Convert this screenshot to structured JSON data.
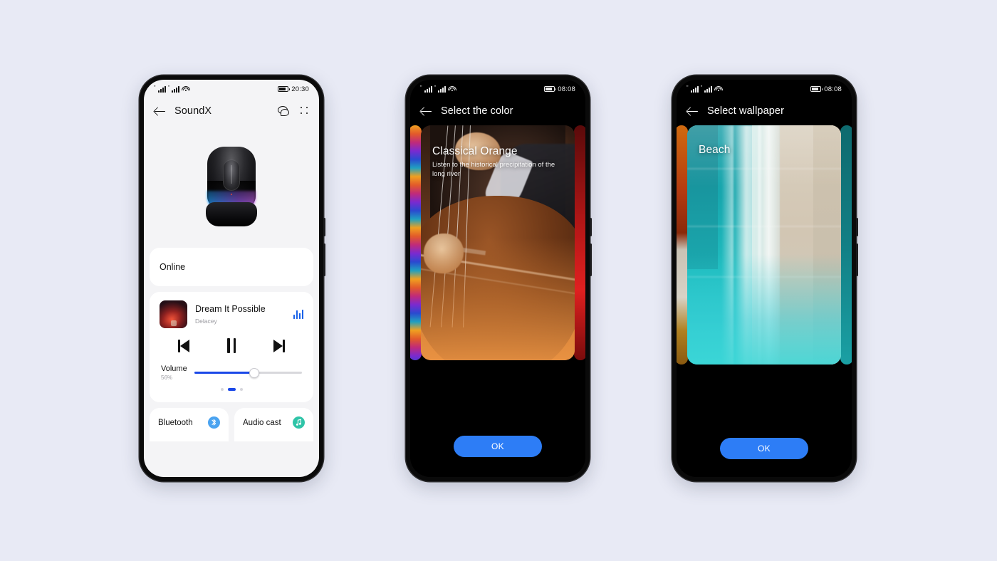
{
  "page": {
    "background_color": "#e8eaf5"
  },
  "phone1": {
    "status_bar": {
      "time": "20:30",
      "signal_label": "signal-bars",
      "wifi_label": "wifi-icon",
      "battery_label": "battery-icon"
    },
    "app_bar": {
      "title": "SoundX",
      "back_icon": "back-arrow-icon",
      "chat_icon": "chat-bubble-icon",
      "more_icon": "grid-dots-icon"
    },
    "device_image_label": "smart-speaker-image",
    "status_card": {
      "text": "Online"
    },
    "player": {
      "album_art_label": "album-art",
      "title": "Dream It Possible",
      "artist": "Delacey",
      "equalizer_label": "equalizer-icon",
      "previous_label": "previous-track-button",
      "pause_label": "pause-button",
      "next_label": "next-track-button",
      "volume_label": "Volume",
      "volume_percent": "56%",
      "volume_value": 56,
      "accent_color": "#1a48e8"
    },
    "pager": {
      "count": 3,
      "active_index": 1
    },
    "bottom_cards": [
      {
        "label": "Bluetooth",
        "icon": "bluetooth-icon",
        "color": "#4aa3f0"
      },
      {
        "label": "Audio cast",
        "icon": "music-note-icon",
        "color": "#2fc4a8"
      }
    ]
  },
  "phone2": {
    "status_bar": {
      "time": "08:08"
    },
    "app_bar": {
      "title": "Select the color",
      "back_icon": "back-arrow-icon"
    },
    "card": {
      "title": "Classical Orange",
      "subtitle": "Listen to the historical precipitation of the long river",
      "image_label": "cello-player-photo"
    },
    "peek_left_label": "previous-theme-preview",
    "peek_right_label": "next-theme-preview",
    "ok_button": {
      "label": "OK",
      "color": "#2d7df6"
    }
  },
  "phone3": {
    "status_bar": {
      "time": "08:08"
    },
    "app_bar": {
      "title": "Select wallpaper",
      "back_icon": "back-arrow-icon"
    },
    "card": {
      "title": "Beach",
      "image_label": "aerial-beach-photo"
    },
    "peek_left_label": "previous-wallpaper-preview",
    "peek_right_label": "next-wallpaper-preview",
    "ok_button": {
      "label": "OK",
      "color": "#2d7df6"
    }
  }
}
